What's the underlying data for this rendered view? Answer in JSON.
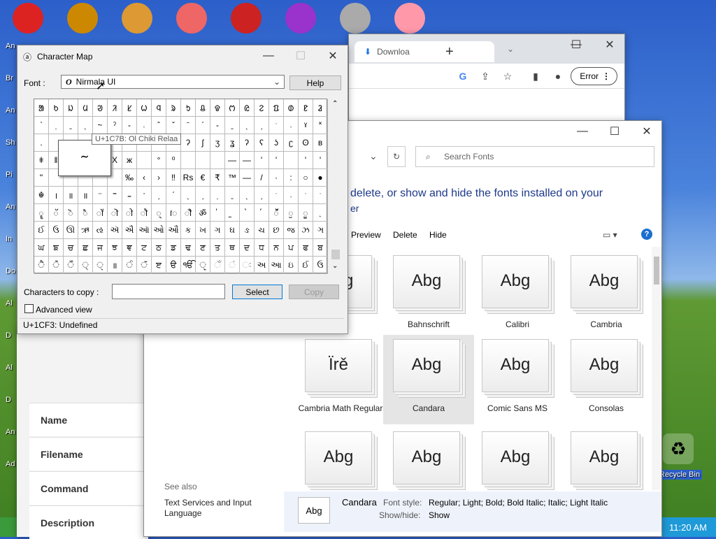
{
  "desktop": {
    "icons": [
      "angry-birds",
      "compass",
      "girl",
      "fish",
      "torii",
      "p-app",
      "pirate",
      "flower"
    ],
    "left_labels": [
      "An",
      "Br",
      "An",
      "Sh",
      "Pi",
      "An",
      "In",
      "Do",
      "Al",
      "D",
      "Al",
      "D",
      "An",
      "Ad"
    ],
    "recycle_bin": "Recycle Bin",
    "clock": "11:20 AM"
  },
  "chrome": {
    "tab_label": "Downloa",
    "new_tab": "+",
    "error_label": "Error"
  },
  "form": {
    "rows": [
      "Name",
      "Filename",
      "Command",
      "Description"
    ]
  },
  "fonts": {
    "search_placeholder": "Search Fonts",
    "heading": "delete, or show and hide the fonts installed on your",
    "heading2": "er",
    "toolbar": {
      "preview": "Preview",
      "delete": "Delete",
      "hide": "Hide"
    },
    "see_also": "See also",
    "link": "Text Services and Input Language",
    "cards": [
      {
        "name": "",
        "sample": "Abg"
      },
      {
        "name": "Bahnschrift",
        "sample": "Abg"
      },
      {
        "name": "Calibri",
        "sample": "Abg"
      },
      {
        "name": "Cambria",
        "sample": "Abg"
      },
      {
        "name": "Cambria Math Regular",
        "sample": "Ïrě"
      },
      {
        "name": "Candara",
        "sample": "Abg"
      },
      {
        "name": "Comic Sans MS",
        "sample": "Abg"
      },
      {
        "name": "Consolas",
        "sample": "Abg"
      },
      {
        "name": "",
        "sample": "Abg"
      },
      {
        "name": "",
        "sample": "Abg"
      },
      {
        "name": "",
        "sample": "Abg"
      },
      {
        "name": "",
        "sample": "Abg"
      }
    ],
    "details": {
      "thumb": "Abg",
      "name": "Candara",
      "style_label": "Font style:",
      "style_value": "Regular; Light; Bold; Bold Italic; Italic; Light Italic",
      "showhide_label": "Show/hide:",
      "showhide_value": "Show"
    }
  },
  "charmap": {
    "title": "Character Map",
    "font_label": "Font :",
    "font_value": "Nirmala UI",
    "help": "Help",
    "tooltip": "U+1C7B: Ol Chiki Relaa",
    "zoom_char": "ᱻ",
    "copy_label": "Characters to copy :",
    "select": "Select",
    "copy": "Copy",
    "advanced": "Advanced view",
    "status": "U+1CF3: Undefined",
    "rows": [
      [
        "ᱟ",
        "ᱠ",
        "ᱡ",
        "ᱢ",
        "ᱣ",
        "ᱤ",
        "ᱥ",
        "ᱦ",
        "ᱧ",
        "ᱨ",
        "ᱩ",
        "ᱪ",
        "ᱫ",
        "ᱬ",
        "ᱭ",
        "ᱮ",
        "ᱯ",
        "ᱰ",
        "ᱱ",
        "ᱲ"
      ],
      [
        "ˋ",
        "ˌ",
        "ˍ",
        "ˎ",
        "~",
        "ˀ",
        "-",
        "˓",
        "ˆ",
        "ˇ",
        "ˉ",
        "ˊ",
        "-",
        "ˍ",
        "ˎ",
        "ˏ",
        "ˑ",
        "˒",
        "ˠ",
        "˟"
      ],
      [
        ".",
        "",
        ":",
        "",
        "",
        "",
        "",
        "",
        "",
        "-",
        "ʔ",
        "ʃ",
        "ʒ",
        "ʓ",
        "ʔ",
        "ʕ",
        "ʖ",
        "ʗ",
        "ʘ",
        "ʙ"
      ],
      [
        "ǂ",
        "ǁ",
        "",
        "",
        "",
        "X",
        "ж",
        "",
        "°",
        "⁰",
        "",
        "",
        "",
        "—",
        "—",
        "'",
        "'",
        "",
        "'",
        "'"
      ],
      [
        "\"",
        "",
        "",
        "",
        "",
        "",
        "‰",
        "‹",
        "›",
        "‼",
        "Rs",
        "€",
        "₹",
        "™",
        "—",
        "/",
        "·",
        ":",
        "○",
        "●"
      ],
      [
        "☬",
        "।",
        "॥",
        "॥",
        "⁻",
        "⁼",
        "₌",
        "ॱ",
        "ˏ",
        "ˊ",
        "ˎ",
        "ˏ",
        "ˌ",
        "ˍ",
        "ˎ",
        "ˏ",
        "ˑ",
        "˒",
        "ˑ",
        "ˑ"
      ],
      [
        "ॄ",
        "ॅ",
        "ॆ",
        "ै",
        "ॉ",
        "ॊ",
        "ो",
        "ौ",
        "्",
        "ॎ",
        "ॏ",
        "ॐ",
        "॑",
        "॒",
        "॓",
        "॔",
        "ॕ",
        "ॖ",
        "ॗ",
        "ˎ"
      ],
      [
        "ઈ",
        "ઉ",
        "ઊ",
        "ઋ",
        "ઌ",
        "ઍ",
        "ઐ",
        "ઑ",
        "ઓ",
        "ઔ",
        "ક",
        "ખ",
        "ગ",
        "ઘ",
        "ઙ",
        "ચ",
        "છ",
        "જ",
        "ઝ",
        "ઞ"
      ],
      [
        "ਘ",
        "ਙ",
        "ਚ",
        "ਛ",
        "ਜ",
        "ਝ",
        "ਞ",
        "ਟ",
        "ਠ",
        "ਡ",
        "ਢ",
        "ਣ",
        "ਤ",
        "ਥ",
        "ਦ",
        "ਧ",
        "ਨ",
        "ਪ",
        "ਫ",
        "ਬ"
      ],
      [
        "ੈ",
        "ੋ",
        "ੌ",
        "੍",
        "ੑ",
        "॥",
        "ੰ",
        "ੱ",
        "ੲ",
        "ੳ",
        "ੴ",
        "ੵ",
        "ઁ",
        "ં",
        "ઃ",
        "અ",
        "આ",
        "ઇ",
        "ઈ",
        "ઉ"
      ]
    ]
  }
}
